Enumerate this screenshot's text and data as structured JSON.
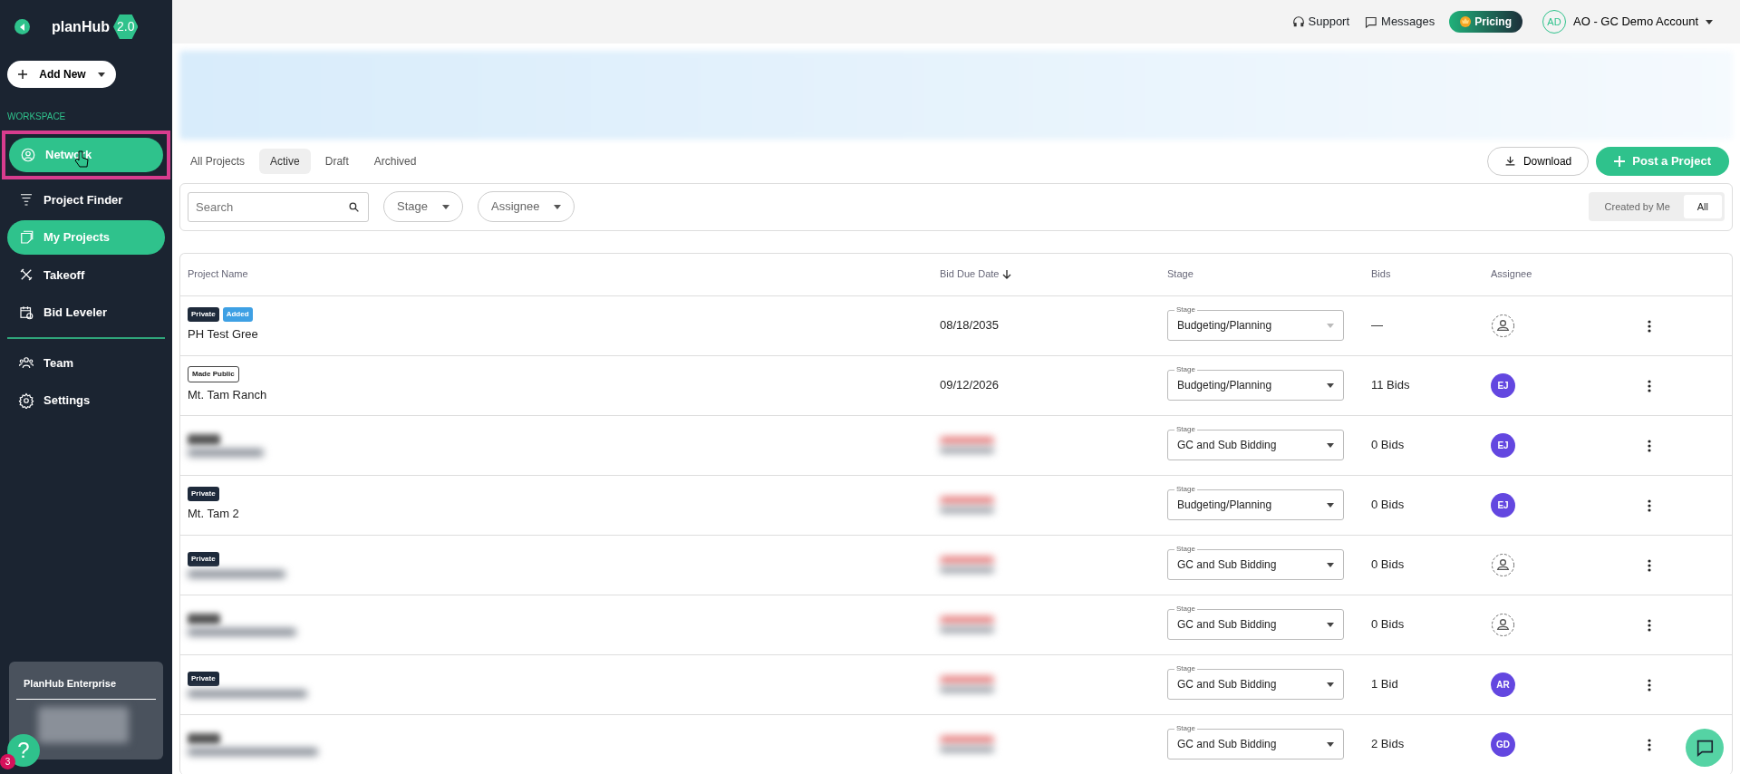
{
  "sidebar": {
    "brand": "planHub",
    "version": "2.0",
    "add_new": "Add New",
    "section": "WORKSPACE",
    "items": [
      {
        "label": "Network",
        "selected": true,
        "callout": true
      },
      {
        "label": "Project Finder",
        "selected": false,
        "callout": false
      },
      {
        "label": "My Projects",
        "selected": true,
        "callout": false
      },
      {
        "label": "Takeoff",
        "selected": false,
        "callout": false
      },
      {
        "label": "Bid Leveler",
        "selected": false,
        "callout": false
      },
      {
        "label": "Team",
        "selected": false,
        "callout": false
      },
      {
        "label": "Settings",
        "selected": false,
        "callout": false
      }
    ],
    "enterprise": {
      "title": "PlanHub Enterprise"
    },
    "help": {
      "label": "?",
      "count": "3"
    }
  },
  "header": {
    "support": "Support",
    "messages": "Messages",
    "pricing": "Pricing",
    "avatar": "AD",
    "account": "AO - GC Demo Account"
  },
  "tabs": [
    {
      "label": "All Projects",
      "selected": false
    },
    {
      "label": "Active",
      "selected": true
    },
    {
      "label": "Draft",
      "selected": false
    },
    {
      "label": "Archived",
      "selected": false
    }
  ],
  "actions": {
    "download": "Download",
    "post": "Post a Project"
  },
  "filters": {
    "search_placeholder": "Search",
    "stage": "Stage",
    "assignee": "Assignee",
    "scope": [
      {
        "label": "Created by Me",
        "selected": false
      },
      {
        "label": "All",
        "selected": true
      }
    ]
  },
  "table": {
    "columns": [
      "Project Name",
      "Bid Due Date",
      "Stage",
      "Bids",
      "Assignee"
    ],
    "rows": [
      {
        "badges": [
          {
            "label": "Private",
            "kind": "private"
          },
          {
            "label": "Added",
            "kind": "added"
          }
        ],
        "name": "PH Test Gree",
        "due_date": "08/18/2035",
        "stage_label": "Stage",
        "stage": "Budgeting/Planning",
        "stage_disabled": true,
        "bids": "—",
        "assignee": null
      },
      {
        "badges": [
          {
            "label": "Made Public",
            "kind": "public"
          }
        ],
        "name": "Mt. Tam Ranch",
        "due_date": "09/12/2026",
        "stage_label": "Stage",
        "stage": "Budgeting/Planning",
        "stage_disabled": false,
        "bids": "11 Bids",
        "assignee": "EJ"
      },
      {
        "badges": [
          {
            "kind": "blurred"
          }
        ],
        "name": null,
        "due_date": null,
        "stage_label": "Stage",
        "stage": "GC and Sub Bidding",
        "stage_disabled": false,
        "bids": "0 Bids",
        "assignee": "EJ"
      },
      {
        "badges": [
          {
            "label": "Private",
            "kind": "private"
          }
        ],
        "name": "Mt. Tam 2",
        "due_date": null,
        "stage_label": "Stage",
        "stage": "Budgeting/Planning",
        "stage_disabled": false,
        "bids": "0 Bids",
        "assignee": "EJ"
      },
      {
        "badges": [
          {
            "label": "Private",
            "kind": "private"
          }
        ],
        "name": null,
        "due_date": null,
        "stage_label": "Stage",
        "stage": "GC and Sub Bidding",
        "stage_disabled": false,
        "bids": "0 Bids",
        "assignee": null
      },
      {
        "badges": [
          {
            "kind": "blurred"
          }
        ],
        "name": null,
        "due_date": null,
        "stage_label": "Stage",
        "stage": "GC and Sub Bidding",
        "stage_disabled": false,
        "bids": "0 Bids",
        "assignee": null
      },
      {
        "badges": [
          {
            "label": "Private",
            "kind": "private"
          }
        ],
        "name": null,
        "due_date": null,
        "stage_label": "Stage",
        "stage": "GC and Sub Bidding",
        "stage_disabled": false,
        "bids": "1 Bid",
        "assignee": "AR"
      },
      {
        "badges": [
          {
            "kind": "blurred"
          }
        ],
        "name": null,
        "due_date": null,
        "stage_label": "Stage",
        "stage": "GC and Sub Bidding",
        "stage_disabled": false,
        "bids": "2 Bids",
        "assignee": "GD"
      }
    ]
  }
}
